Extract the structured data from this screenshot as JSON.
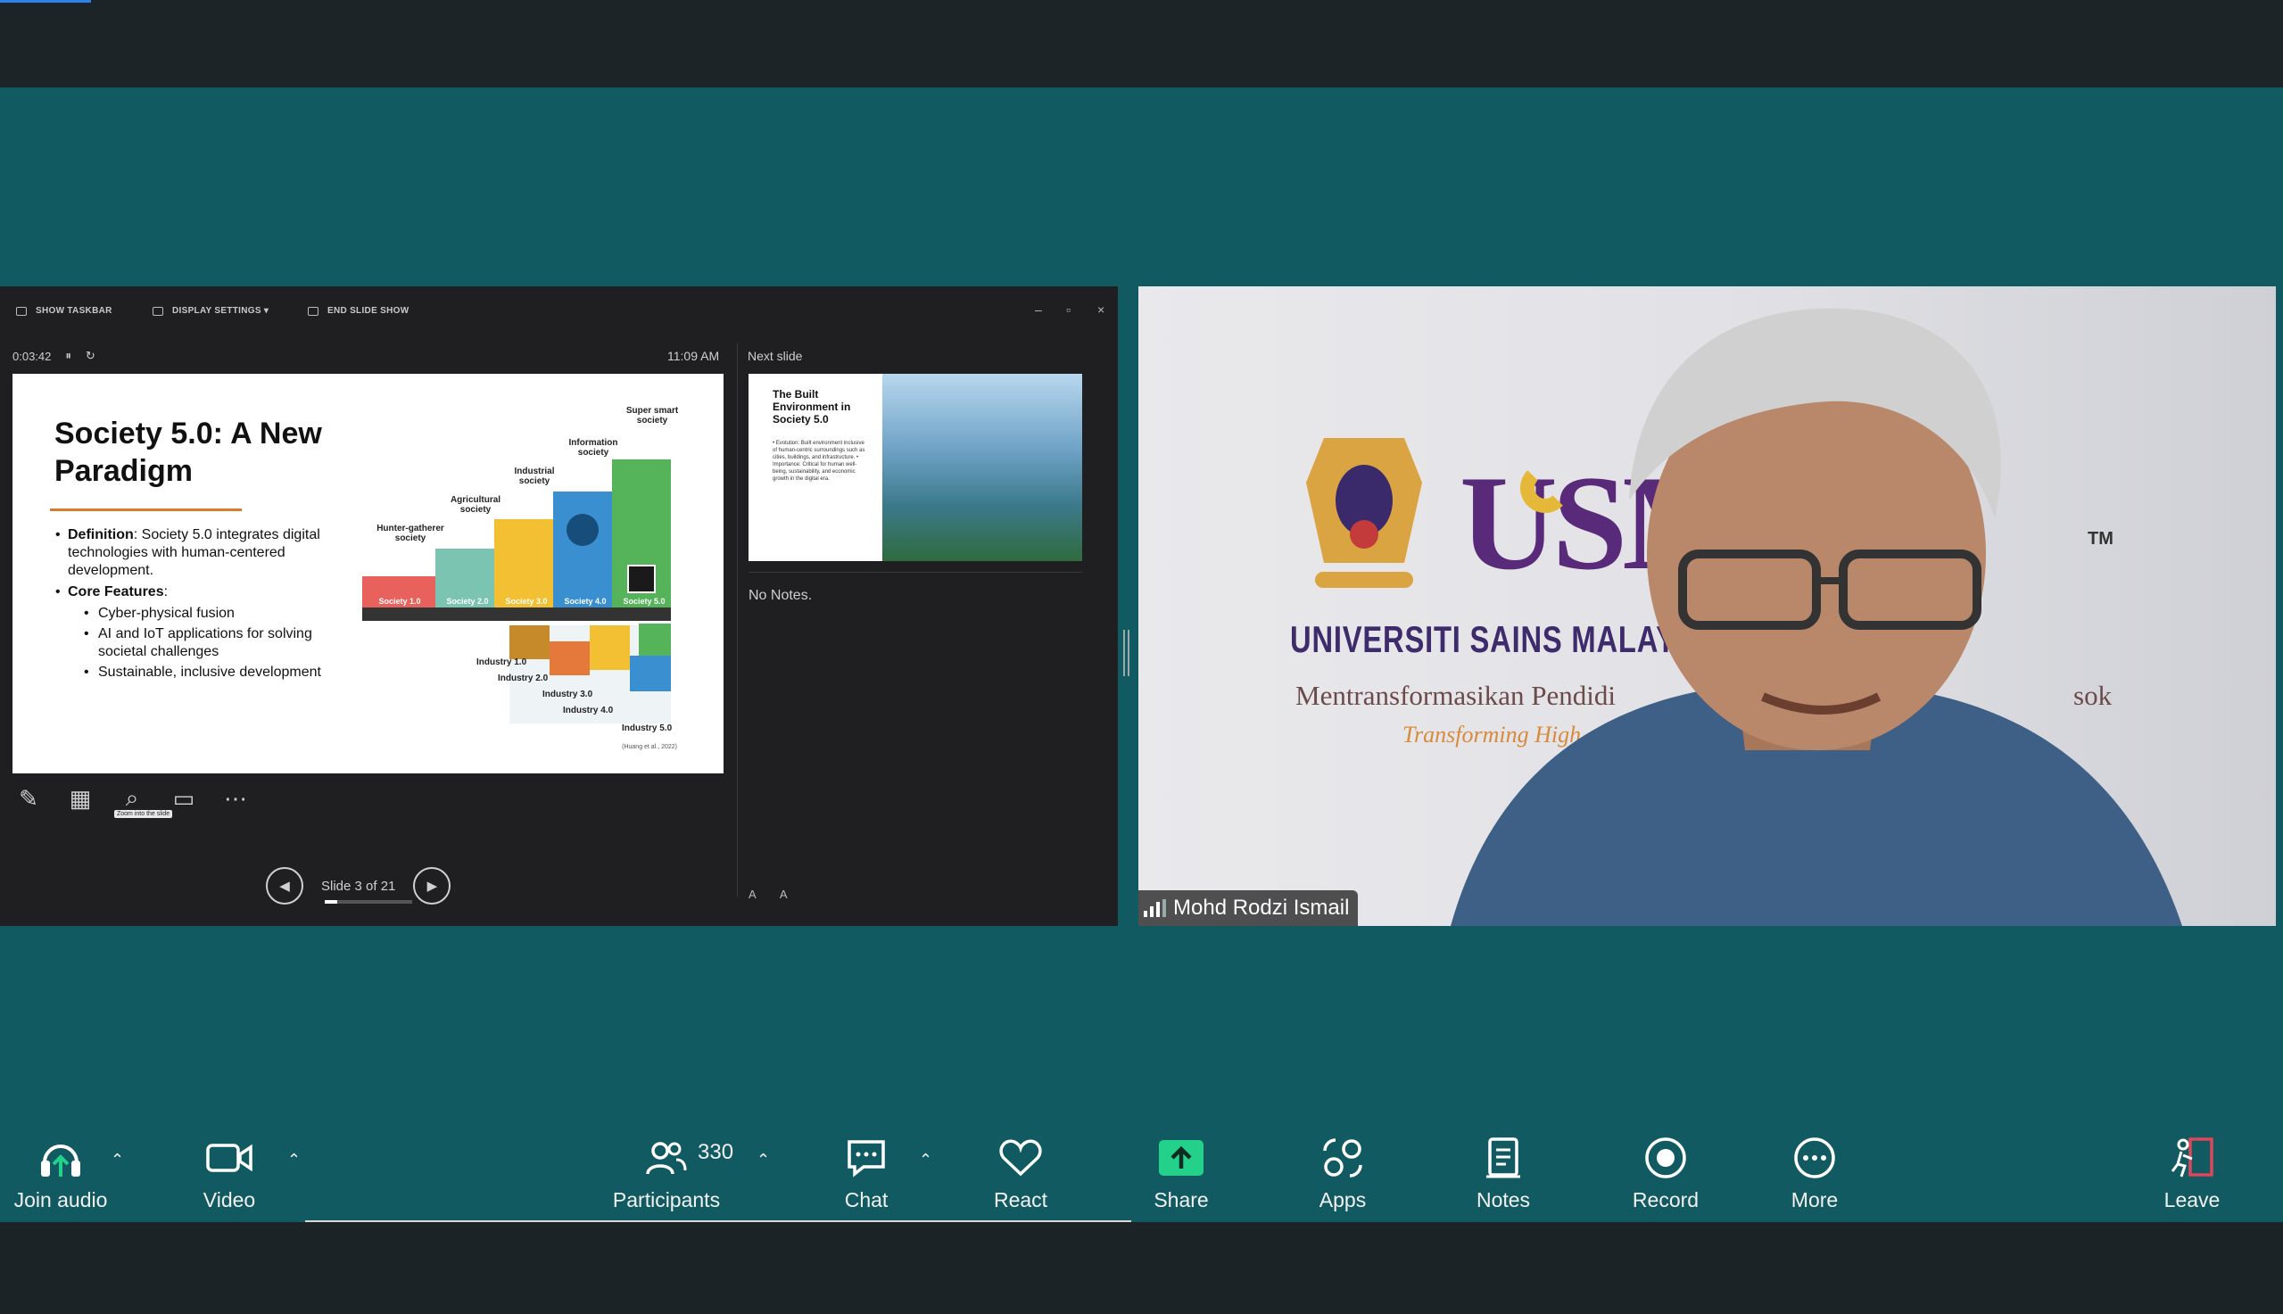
{
  "colors": {
    "stage": "#125a61",
    "share_button": "#23d18b",
    "leave_icon": "#e0455a",
    "slide_rule": "#d97b2e"
  },
  "presenter_toolbar": {
    "show_taskbar": "SHOW TASKBAR",
    "display_settings": "DISPLAY SETTINGS ▾",
    "end_slide_show": "END SLIDE SHOW"
  },
  "presenter": {
    "timer": "0:03:42",
    "clock": "11:09 AM",
    "next_slide_label": "Next slide",
    "notes_text": "No Notes.",
    "zoom_tooltip": "Zoom into the slide",
    "slide_counter": "Slide 3 of 21",
    "slide_progress": 0.14
  },
  "slide": {
    "title": "Society 5.0: A New Paradigm",
    "definition_label": "Definition",
    "definition_text": ": Society 5.0 integrates digital technologies with human-centered development.",
    "core_label": "Core Features",
    "core_colon": ":",
    "features": [
      "Cyber-physical fusion",
      "AI and IoT applications for solving societal challenges",
      "Sustainable, inclusive development"
    ],
    "societies": [
      "Hunter-gatherer society",
      "Agricultural society",
      "Industrial society",
      "Information society",
      "Super smart society"
    ],
    "society_levels": [
      "Society 1.0",
      "Society 2.0",
      "Society 3.0",
      "Society 4.0",
      "Society 5.0"
    ],
    "industries": [
      "Industry 1.0",
      "Industry 2.0",
      "Industry 3.0",
      "Industry 4.0",
      "Industry 5.0"
    ],
    "citation": "(Huang et al., 2022)"
  },
  "next_slide": {
    "title": "The Built Environment in Society 5.0",
    "body": "• Evolution: Built environment inclusive of human-centric surroundings such as cities, buildings, and infrastructure. • Importance: Critical for human well-being, sustainability, and economic growth in the digital era."
  },
  "video": {
    "participant_name": "Mohd Rodzi Ismail",
    "logo_text": "USM",
    "trademark": "TM",
    "university": "UNIVERSITI SAINS MALAYS",
    "tagline": "Mentransformasikan Pendidi",
    "tagline_end": "sok",
    "tagline_en": "Transforming High"
  },
  "controls": {
    "join_audio": "Join audio",
    "video": "Video",
    "participants": "Participants",
    "participant_count": "330",
    "chat": "Chat",
    "react": "React",
    "share": "Share",
    "apps": "Apps",
    "notes": "Notes",
    "record": "Record",
    "more": "More",
    "leave": "Leave"
  }
}
